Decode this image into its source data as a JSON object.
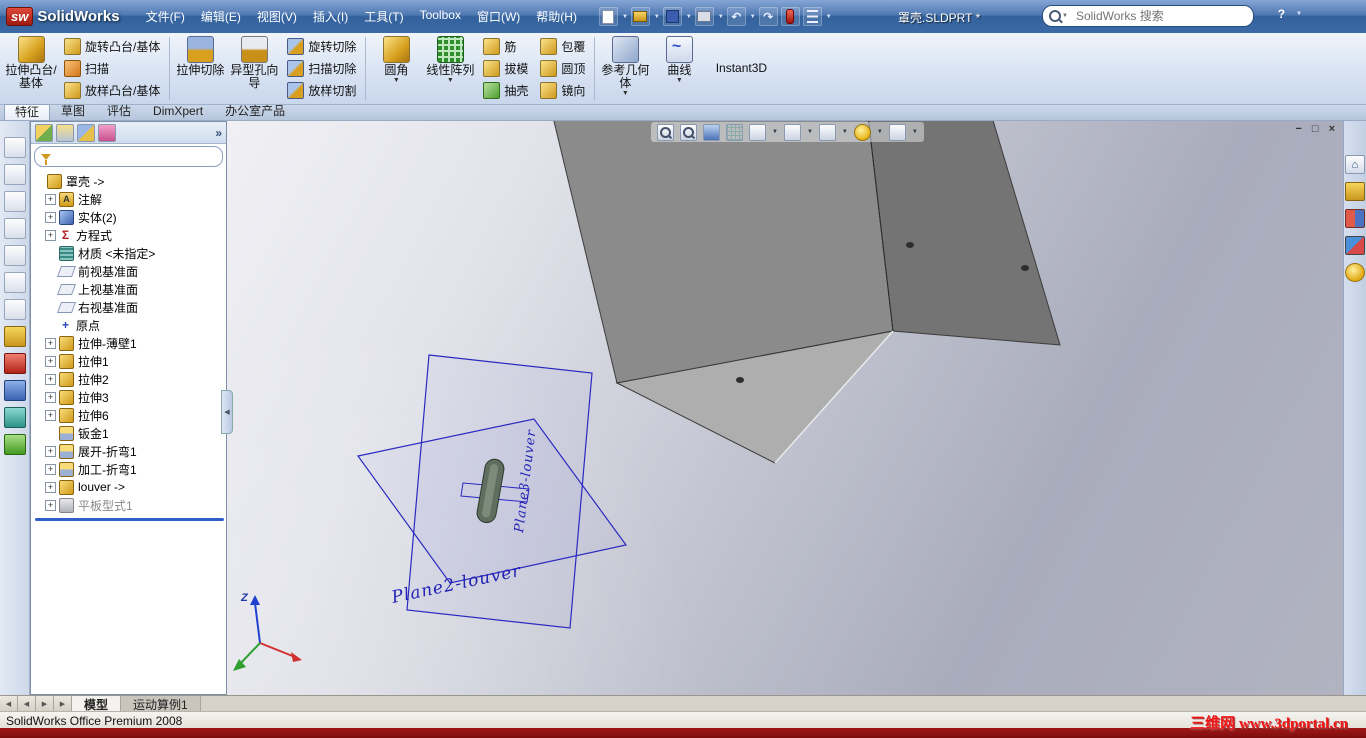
{
  "title_bar": {
    "app_name": "SolidWorks",
    "logo_prefix": "sw",
    "menus": [
      "文件(F)",
      "编辑(E)",
      "视图(V)",
      "插入(I)",
      "工具(T)",
      "Toolbox",
      "窗口(W)",
      "帮助(H)"
    ],
    "document_title": "罩壳.SLDPRT *",
    "search_placeholder": "SolidWorks 搜索"
  },
  "ribbon": {
    "extrude_boss": "拉伸凸台/基体",
    "revolve_boss": "旋转凸台/基体",
    "sweep": "扫描",
    "loft_boss": "放样凸台/基体",
    "extrude_cut": "拉伸切除",
    "hole_wizard": "异型孔向导",
    "revolve_cut": "旋转切除",
    "sweep_cut": "扫描切除",
    "loft_cut": "放样切割",
    "fillet": "圆角",
    "linear_pattern": "线性阵列",
    "rib": "筋",
    "draft": "拔模",
    "shell": "抽壳",
    "wrap": "包覆",
    "dome": "圆顶",
    "mirror": "镜向",
    "reference_geometry": "参考几何体",
    "curves": "曲线",
    "instant3d": "Instant3D"
  },
  "command_tabs": [
    "特征",
    "草图",
    "评估",
    "DimXpert",
    "办公室产品"
  ],
  "feature_tree": {
    "items": [
      {
        "label": "罩壳 ->"
      },
      {
        "label": "注解"
      },
      {
        "label": "实体(2)"
      },
      {
        "label": "方程式"
      },
      {
        "label": "材质 <未指定>"
      },
      {
        "label": "前视基准面"
      },
      {
        "label": "上视基准面"
      },
      {
        "label": "右视基准面"
      },
      {
        "label": "原点"
      },
      {
        "label": "拉伸-薄壁1"
      },
      {
        "label": "拉伸1"
      },
      {
        "label": "拉伸2"
      },
      {
        "label": "拉伸3"
      },
      {
        "label": "拉伸6"
      },
      {
        "label": "钣金1"
      },
      {
        "label": "展开-折弯1"
      },
      {
        "label": "加工-折弯1"
      },
      {
        "label": "louver ->"
      },
      {
        "label": "平板型式1"
      }
    ]
  },
  "viewport": {
    "plane3_label": "Plane3-louver",
    "plane2_label": "Plane2-louver",
    "triad_z": "Z"
  },
  "bottom_bar": {
    "tabs": [
      "模型",
      "运动算例1"
    ]
  },
  "status_bar": {
    "left_text": "SolidWorks Office Premium 2008",
    "watermark": "三维网 www.3dportal.cn"
  },
  "glyphs": {
    "dropdown": "▼",
    "overflow": "»",
    "help": "?",
    "minimize": "−",
    "restore": "□",
    "close": "×",
    "plus": "+",
    "annotation": "A",
    "equations": "Σ",
    "origin": "+",
    "undo": "↶",
    "redo": "↷",
    "left": "◀",
    "right": "▶"
  },
  "colors": {
    "titlebar_blue": "#3c6aa6",
    "plane_blue": "#2222b4",
    "accent_gold": "#d8a01e",
    "watermark_red": "#f21414",
    "bottom_strip_red": "#8b1010"
  }
}
